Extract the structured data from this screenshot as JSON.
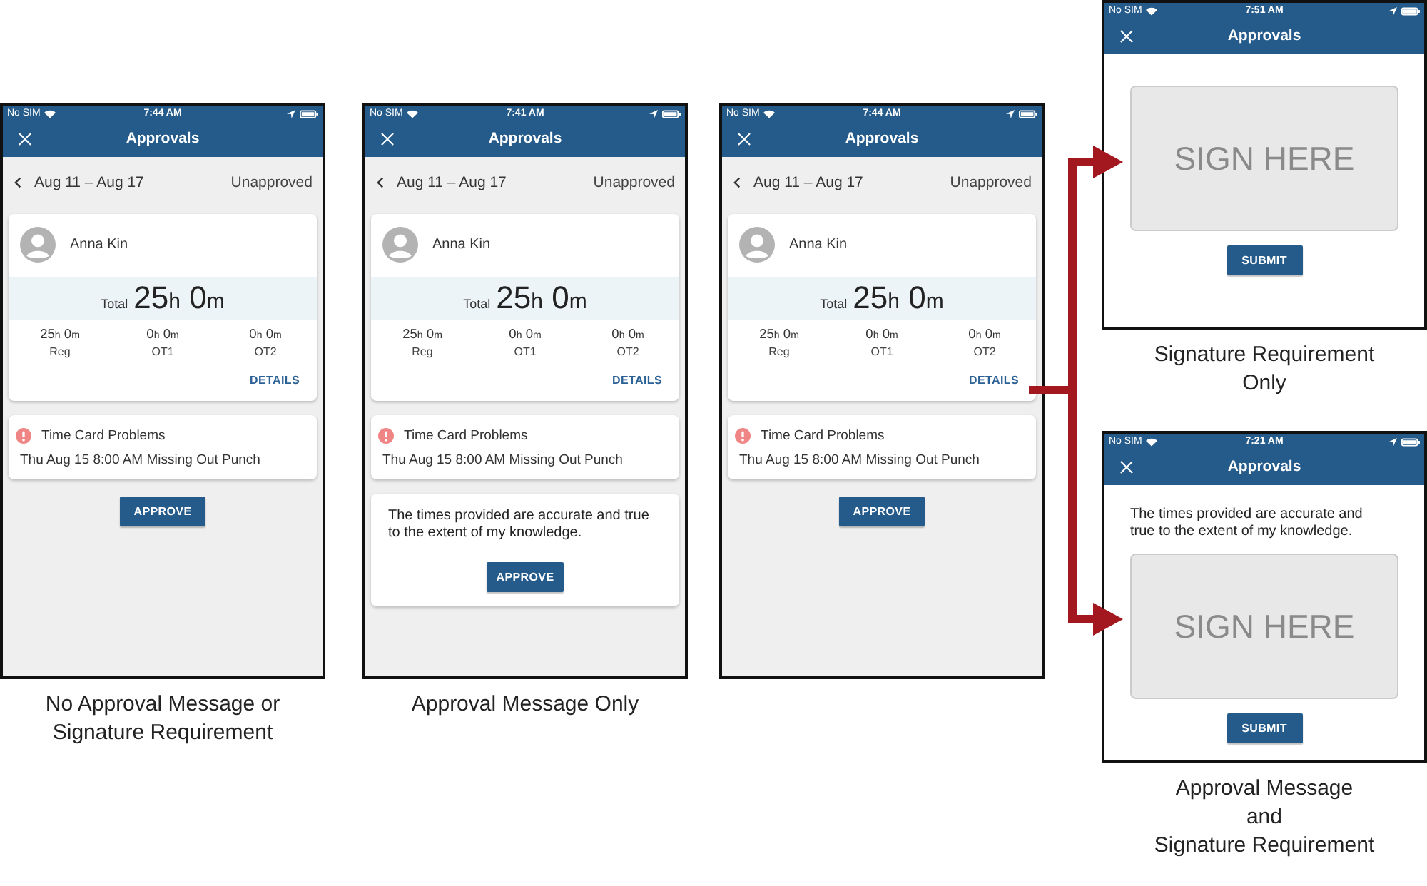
{
  "screens": [
    {
      "kind": "timecard",
      "status_bar": {
        "carrier": "No SIM",
        "time": "7:44 AM"
      },
      "header": {
        "title": "Approvals"
      },
      "period": {
        "range": "Aug 11 – Aug 17",
        "status": "Unapproved"
      },
      "employee": {
        "name": "Anna Kin"
      },
      "total": {
        "label": "Total",
        "value": [
          {
            "num": "25",
            "unit": "h"
          },
          {
            "num": "0",
            "unit": "m"
          }
        ]
      },
      "breakdown": [
        {
          "value": [
            {
              "num": "25",
              "unit": "h"
            },
            {
              "num": "0",
              "unit": "m"
            }
          ],
          "label": "Reg"
        },
        {
          "value": [
            {
              "num": "0",
              "unit": "h"
            },
            {
              "num": "0",
              "unit": "m"
            }
          ],
          "label": "OT1"
        },
        {
          "value": [
            {
              "num": "0",
              "unit": "h"
            },
            {
              "num": "0",
              "unit": "m"
            }
          ],
          "label": "OT2"
        }
      ],
      "details_link": "DETAILS",
      "problems": {
        "title": "Time Card Problems",
        "items": [
          "Thu Aug 15 8:00 AM Missing Out Punch"
        ]
      },
      "approval": {
        "button": "APPROVE"
      },
      "caption": [
        "No Approval Message or",
        "Signature Requirement"
      ]
    },
    {
      "kind": "timecard",
      "status_bar": {
        "carrier": "No SIM",
        "time": "7:41 AM"
      },
      "header": {
        "title": "Approvals"
      },
      "period": {
        "range": "Aug 11 – Aug 17",
        "status": "Unapproved"
      },
      "employee": {
        "name": "Anna Kin"
      },
      "total": {
        "label": "Total",
        "value": [
          {
            "num": "25",
            "unit": "h"
          },
          {
            "num": "0",
            "unit": "m"
          }
        ]
      },
      "breakdown": [
        {
          "value": [
            {
              "num": "25",
              "unit": "h"
            },
            {
              "num": "0",
              "unit": "m"
            }
          ],
          "label": "Reg"
        },
        {
          "value": [
            {
              "num": "0",
              "unit": "h"
            },
            {
              "num": "0",
              "unit": "m"
            }
          ],
          "label": "OT1"
        },
        {
          "value": [
            {
              "num": "0",
              "unit": "h"
            },
            {
              "num": "0",
              "unit": "m"
            }
          ],
          "label": "OT2"
        }
      ],
      "details_link": "DETAILS",
      "problems": {
        "title": "Time Card Problems",
        "items": [
          "Thu Aug 15 8:00 AM Missing Out Punch"
        ]
      },
      "approval": {
        "message": "The times provided are accurate and true to the extent of my knowledge.",
        "button": "APPROVE"
      },
      "caption": [
        "Approval Message Only"
      ]
    },
    {
      "kind": "timecard",
      "status_bar": {
        "carrier": "No SIM",
        "time": "7:44 AM"
      },
      "header": {
        "title": "Approvals"
      },
      "period": {
        "range": "Aug 11 – Aug 17",
        "status": "Unapproved"
      },
      "employee": {
        "name": "Anna Kin"
      },
      "total": {
        "label": "Total",
        "value": [
          {
            "num": "25",
            "unit": "h"
          },
          {
            "num": "0",
            "unit": "m"
          }
        ]
      },
      "breakdown": [
        {
          "value": [
            {
              "num": "25",
              "unit": "h"
            },
            {
              "num": "0",
              "unit": "m"
            }
          ],
          "label": "Reg"
        },
        {
          "value": [
            {
              "num": "0",
              "unit": "h"
            },
            {
              "num": "0",
              "unit": "m"
            }
          ],
          "label": "OT1"
        },
        {
          "value": [
            {
              "num": "0",
              "unit": "h"
            },
            {
              "num": "0",
              "unit": "m"
            }
          ],
          "label": "OT2"
        }
      ],
      "details_link": "DETAILS",
      "problems": {
        "title": "Time Card Problems",
        "items": [
          "Thu Aug 15 8:00 AM Missing Out Punch"
        ]
      },
      "approval": {
        "button": "APPROVE"
      }
    },
    {
      "kind": "signature",
      "status_bar": {
        "carrier": "No SIM",
        "time": "7:51 AM"
      },
      "header": {
        "title": "Approvals"
      },
      "signature_pad": {
        "placeholder": "SIGN HERE"
      },
      "submit_button": "SUBMIT",
      "caption": [
        "Signature Requirement",
        "Only"
      ]
    },
    {
      "kind": "signature",
      "status_bar": {
        "carrier": "No SIM",
        "time": "7:21 AM"
      },
      "header": {
        "title": "Approvals"
      },
      "message": "The times provided are accurate and true to the extent of my knowledge.",
      "signature_pad": {
        "placeholder": "SIGN HERE"
      },
      "submit_button": "SUBMIT",
      "caption": [
        "Approval Message",
        "and",
        "Signature Requirement"
      ]
    }
  ]
}
